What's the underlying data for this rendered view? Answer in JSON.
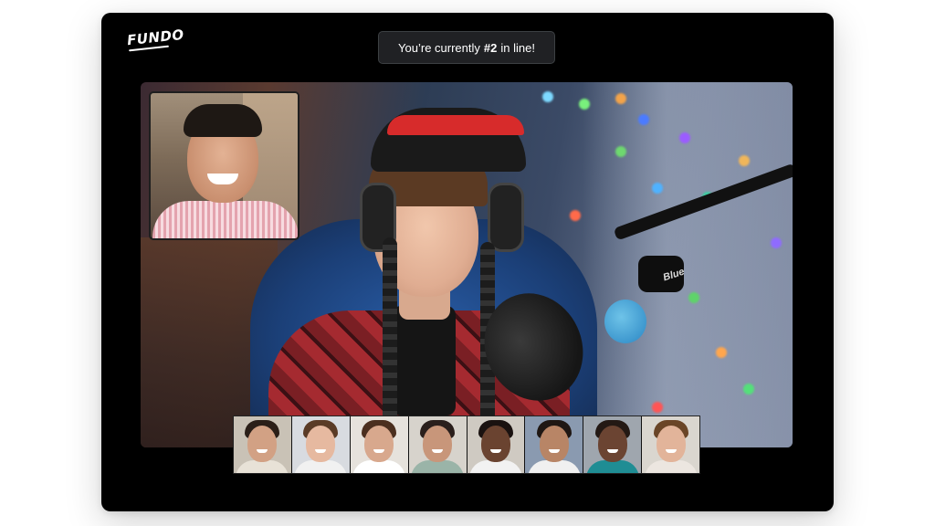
{
  "app": {
    "logo": "FUNDO"
  },
  "queue_status": {
    "prefix": "You’re currently",
    "position": "#2",
    "suffix": "in line!"
  },
  "main_video": {
    "mic_brand": "Blue"
  },
  "participants": [
    {
      "skin": "#d2a184",
      "hair": "#2b1f18",
      "shirt": "#e8e2d7",
      "bg": "#c9c2b6"
    },
    {
      "skin": "#e6b9a0",
      "hair": "#5a3b26",
      "shirt": "#f1f1f1",
      "bg": "#d8dbe0"
    },
    {
      "skin": "#d8a88d",
      "hair": "#4b2f1f",
      "shirt": "#ffffff",
      "bg": "#e6e2dc"
    },
    {
      "skin": "#c8967a",
      "hair": "#2a1f1c",
      "shirt": "#9ab4a8",
      "bg": "#d7d3cc"
    },
    {
      "skin": "#6a4330",
      "hair": "#1a1210",
      "shirt": "#f2f2f2",
      "bg": "#cfcac2"
    },
    {
      "skin": "#b88566",
      "hair": "#1f1713",
      "shirt": "#f0f0f0",
      "bg": "#8a9ab0"
    },
    {
      "skin": "#6b4432",
      "hair": "#241914",
      "shirt": "#1f8d94",
      "bg": "#9fa6ae"
    },
    {
      "skin": "#e2b49a",
      "hair": "#6a4527",
      "shirt": "#ece6e0",
      "bg": "#dad6cf"
    }
  ],
  "colors": {
    "window_bg": "#000000",
    "pill_bg": "#202124",
    "beanie_stripe": "#d72b2b"
  }
}
